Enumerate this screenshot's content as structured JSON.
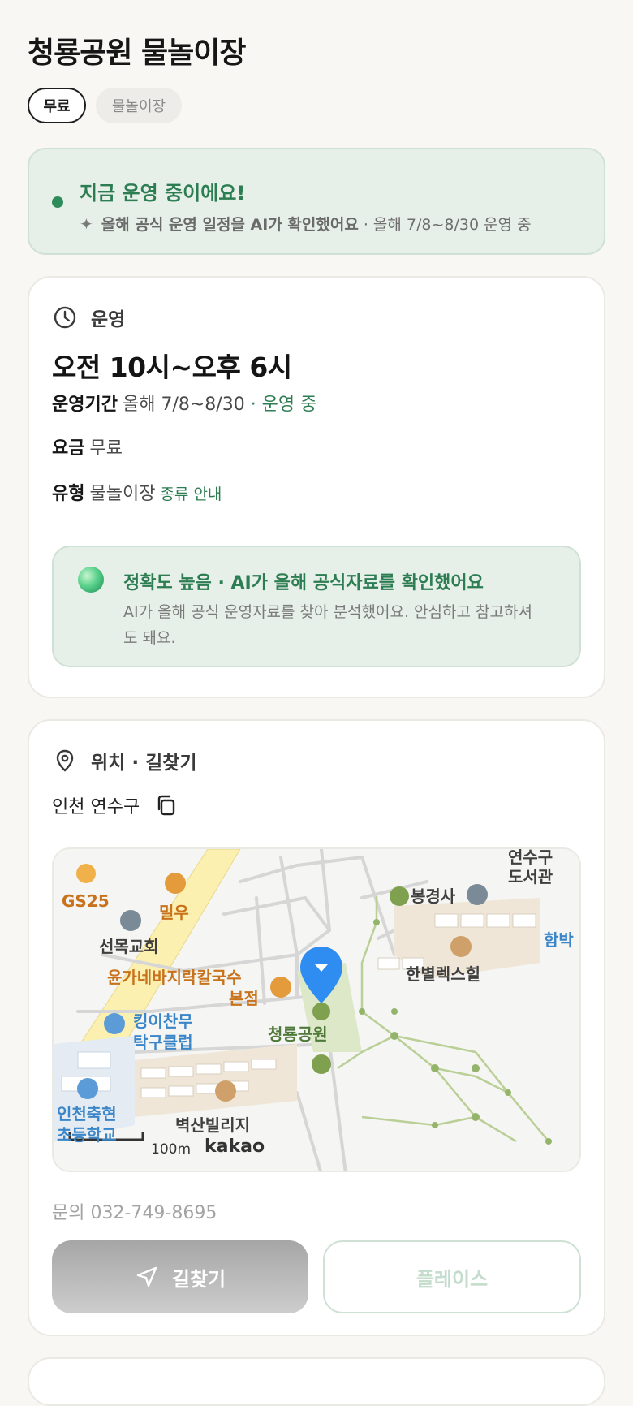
{
  "header": {
    "title": "청룡공원 물놀이장",
    "tags": [
      "무료",
      "물놀이장"
    ]
  },
  "status": {
    "headline": "지금 운영 중이에요!",
    "ai_note": "올해 공식 운영 일정을 AI가 확인했어요",
    "period_note": "· 올해 7/8~8/30 운영 중",
    "icons": {
      "dot": "status-dot-icon",
      "spark": "sparkle-icon"
    }
  },
  "operation": {
    "section_title": "운영",
    "section_icon": "clock-icon",
    "hours": "오전 10시~오후 6시",
    "period_label": "운영기간",
    "period_value": "올해 7/8~8/30",
    "period_status": "· 운영 중",
    "fee_label": "요금",
    "fee_value": "무료",
    "type_label": "유형",
    "type_value": "물놀이장",
    "type_link": "종류 안내",
    "accuracy": {
      "headline": "정확도 높음 · AI가 올해 공식자료를 확인했어요",
      "body": "AI가 올해 공식 운영자료를 찾아 분석했어요. 안심하고 참고하셔도 돼요."
    }
  },
  "location": {
    "section_title": "위치 · 길찾기",
    "section_icon": "location-pin-icon",
    "address": "인천 연수구",
    "copy_icon": "copy-icon",
    "map": {
      "labels": {
        "gs25": "GS25",
        "milwoo": "밀우",
        "church": "선목교회",
        "noodle1": "윤가네바지락칼국수",
        "noodle2": "본점",
        "table_tennis1": "킹이찬무",
        "table_tennis2": "탁구클럽",
        "school1": "인천축현",
        "school2": "초등학교",
        "temple": "봉경사",
        "apartment": "한별렉스힐",
        "villa": "벽산빌리지",
        "park": "청룡공원",
        "library1": "연수구",
        "library2": "도서관",
        "edge": "함박",
        "scale": "100m",
        "brand": "kakao"
      }
    },
    "phone": "문의 032-749-8695",
    "route_button": "길찾기",
    "place_button": "플레이스"
  }
}
